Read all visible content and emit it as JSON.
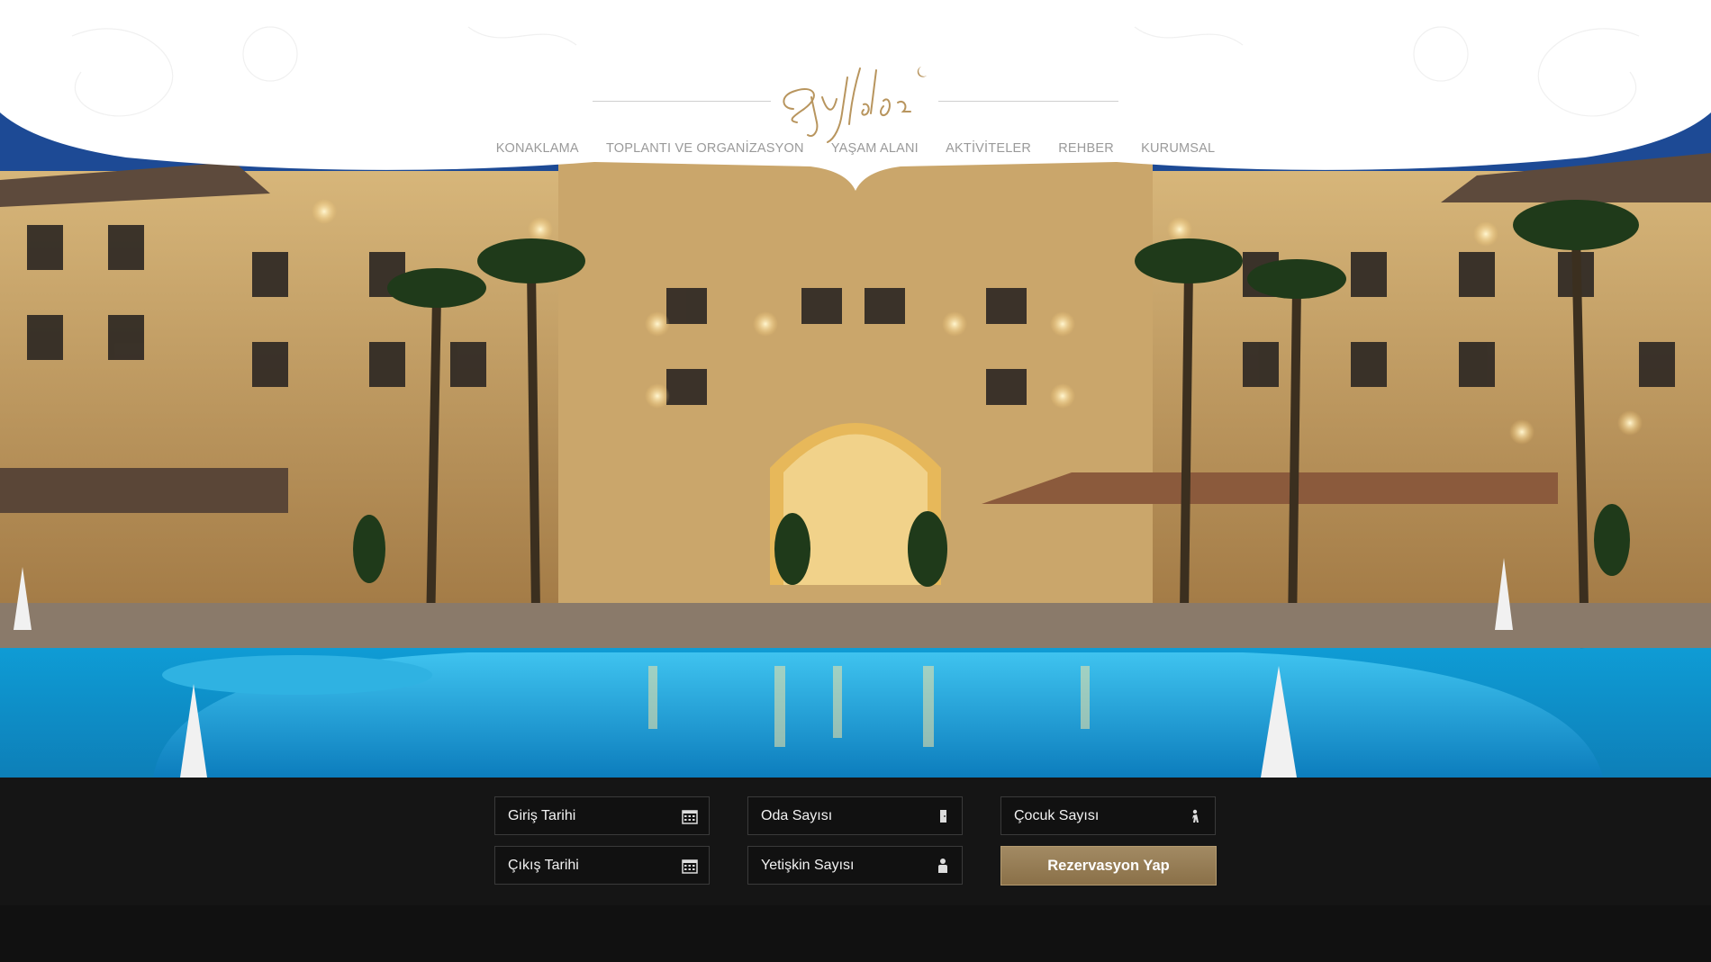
{
  "brand": {
    "logo_name": "ay-yildiz-logo"
  },
  "nav": {
    "items": [
      {
        "label": "KONAKLAMA"
      },
      {
        "label": "TOPLANTI VE ORGANİZASYON"
      },
      {
        "label": "YAŞAM ALANI"
      },
      {
        "label": "AKTİVİTELER"
      },
      {
        "label": "REHBER"
      },
      {
        "label": "KURUMSAL"
      }
    ]
  },
  "booking": {
    "checkin": {
      "placeholder": "Giriş Tarihi",
      "icon": "calendar-icon"
    },
    "checkout": {
      "placeholder": "Çıkış Tarihi",
      "icon": "calendar-icon"
    },
    "rooms": {
      "placeholder": "Oda Sayısı",
      "icon": "door-icon"
    },
    "adults": {
      "placeholder": "Yetişkin Sayısı",
      "icon": "adult-icon"
    },
    "children": {
      "placeholder": "Çocuk Sayısı",
      "icon": "child-icon"
    },
    "submit_label": "Rezervasyon Yap"
  },
  "colors": {
    "accent_gold": "#9a8058",
    "bar_bg": "#151515"
  }
}
